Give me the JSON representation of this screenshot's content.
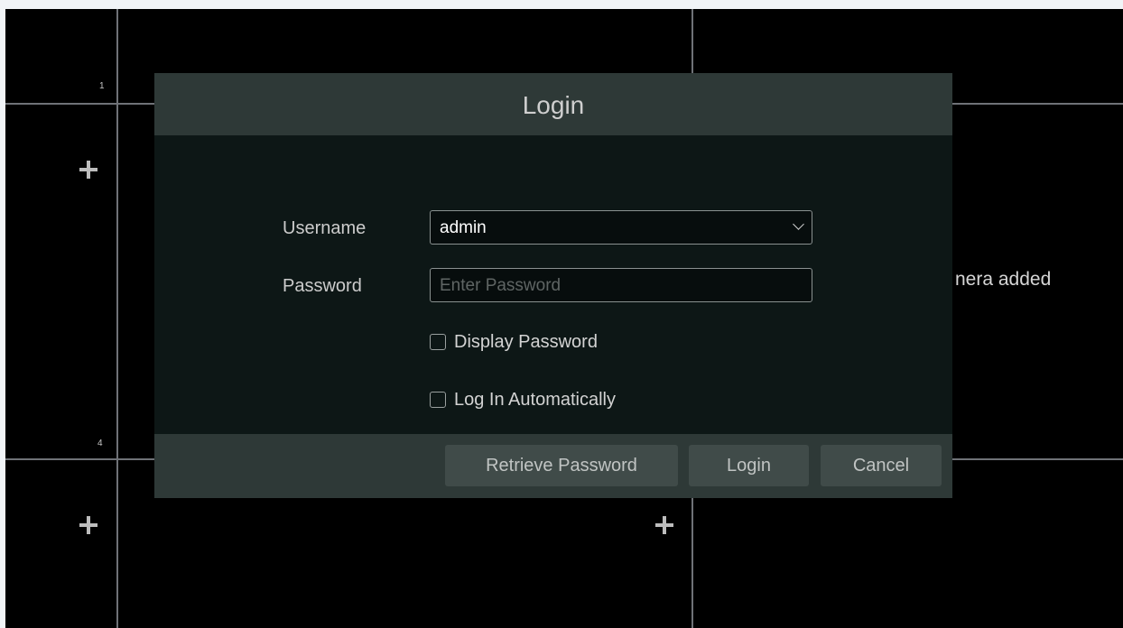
{
  "background": {
    "tile_numbers": [
      "1",
      "4"
    ],
    "partial_message": "nera added"
  },
  "dialog": {
    "title": "Login",
    "username": {
      "label": "Username",
      "value": "admin"
    },
    "password": {
      "label": "Password",
      "placeholder": "Enter Password"
    },
    "display_password": {
      "label": "Display Password",
      "checked": false
    },
    "log_in_automatically": {
      "label": "Log In Automatically",
      "checked": false
    },
    "buttons": {
      "retrieve_password": "Retrieve Password",
      "login": "Login",
      "cancel": "Cancel"
    }
  },
  "colors": {
    "header_bg": "#2e3937",
    "body_bg": "#0d1716",
    "button_bg": "#404b49"
  }
}
